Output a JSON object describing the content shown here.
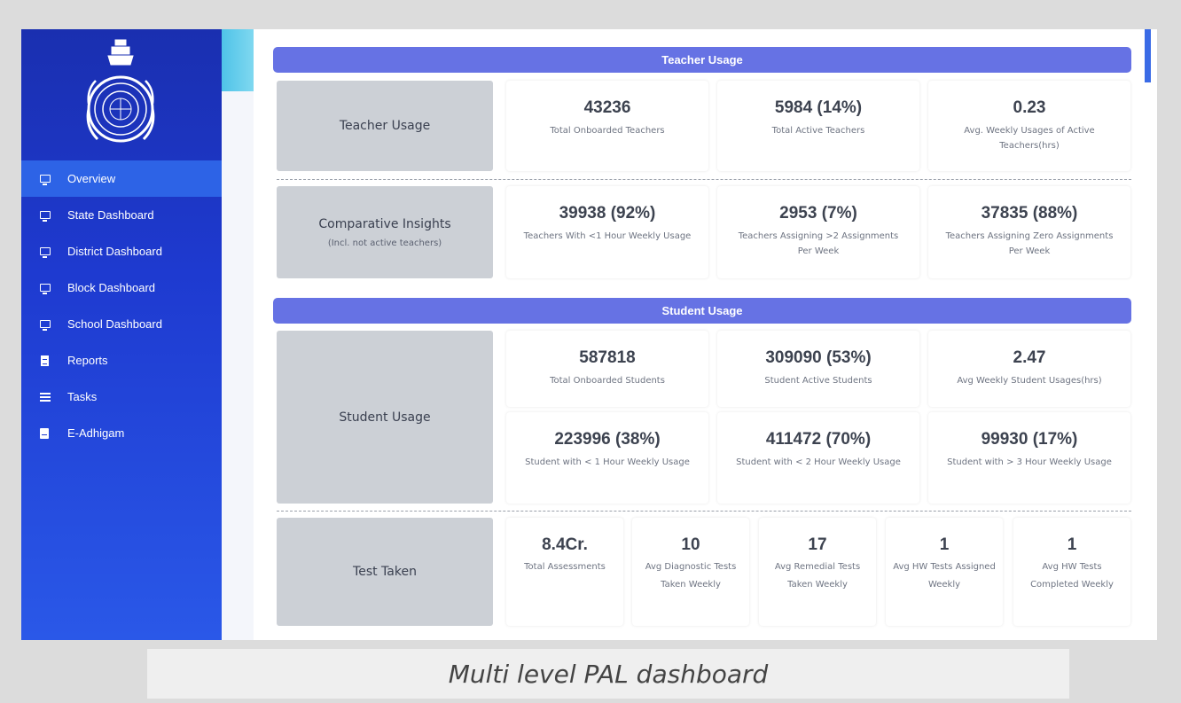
{
  "sidebar": {
    "items": [
      {
        "label": "Overview",
        "icon": "monitor-icon"
      },
      {
        "label": "State Dashboard",
        "icon": "monitor-icon"
      },
      {
        "label": "District Dashboard",
        "icon": "monitor-icon"
      },
      {
        "label": "Block Dashboard",
        "icon": "monitor-icon"
      },
      {
        "label": "School Dashboard",
        "icon": "monitor-icon"
      },
      {
        "label": "Reports",
        "icon": "document-icon"
      },
      {
        "label": "Tasks",
        "icon": "list-icon"
      },
      {
        "label": "E-Adhigam",
        "icon": "book-icon"
      }
    ]
  },
  "teacher": {
    "title": "Teacher Usage",
    "usage_label": "Teacher Usage",
    "stats": [
      {
        "value": "43236",
        "caption": "Total Onboarded Teachers"
      },
      {
        "value": "5984 (14%)",
        "caption": "Total Active Teachers"
      },
      {
        "value": "0.23",
        "caption": "Avg. Weekly Usages of Active Teachers(hrs)"
      }
    ],
    "insights_label": "Comparative Insights",
    "insights_sub": "(Incl. not active teachers)",
    "insights": [
      {
        "value": "39938 (92%)",
        "caption": "Teachers With <1 Hour Weekly Usage"
      },
      {
        "value": "2953 (7%)",
        "caption": "Teachers Assigning >2 Assignments Per Week"
      },
      {
        "value": "37835 (88%)",
        "caption": "Teachers Assigning Zero Assignments Per Week"
      }
    ]
  },
  "student": {
    "title": "Student Usage",
    "usage_label": "Student Usage",
    "stats": [
      {
        "value": "587818",
        "caption": "Total Onboarded Students"
      },
      {
        "value": "309090 (53%)",
        "caption": "Student Active Students"
      },
      {
        "value": "2.47",
        "caption": "Avg Weekly Student Usages(hrs)"
      },
      {
        "value": "223996 (38%)",
        "caption": "Student with < 1 Hour Weekly Usage"
      },
      {
        "value": "411472 (70%)",
        "caption": "Student with < 2 Hour Weekly Usage"
      },
      {
        "value": "99930 (17%)",
        "caption": "Student with > 3 Hour Weekly Usage"
      }
    ],
    "tests_label": "Test Taken",
    "tests": [
      {
        "value": "8.4Cr.",
        "caption": "Total Assessments"
      },
      {
        "value": "10",
        "caption": "Avg Diagnostic Tests Taken Weekly"
      },
      {
        "value": "17",
        "caption": "Avg Remedial Tests Taken Weekly"
      },
      {
        "value": "1",
        "caption": "Avg HW Tests Assigned Weekly"
      },
      {
        "value": "1",
        "caption": "Avg HW Tests Completed Weekly"
      }
    ]
  },
  "caption": "Multi level PAL dashboard",
  "colors": {
    "sidebar": "#1e3ad0",
    "active_item": "#2d63e6",
    "section_bar": "#6672e4",
    "label_box": "#ccd0d6"
  }
}
